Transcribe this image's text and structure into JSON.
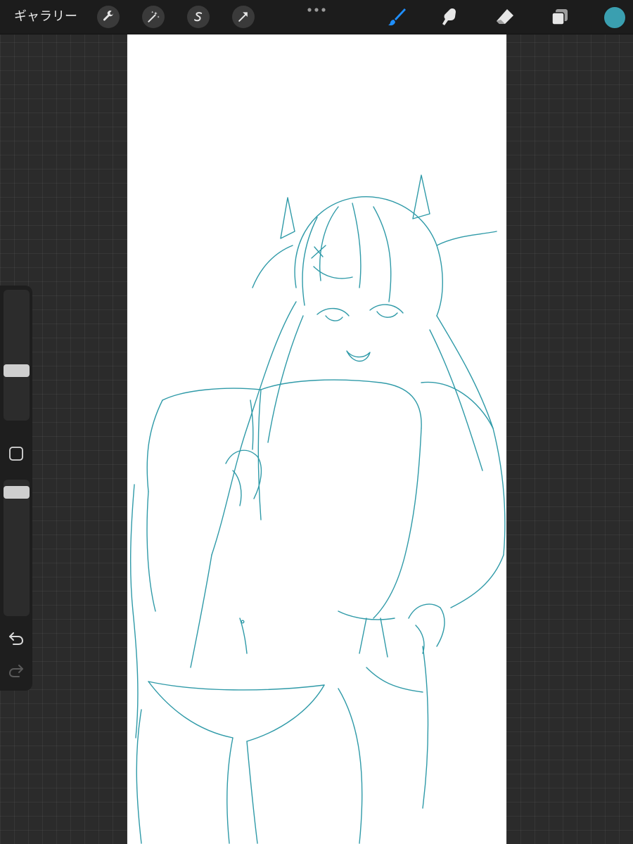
{
  "topbar": {
    "gallery_label": "ギャラリー",
    "left_tools": [
      {
        "name": "actions-button",
        "icon": "wrench-icon"
      },
      {
        "name": "adjustments-button",
        "icon": "magic-wand-icon"
      },
      {
        "name": "selection-button",
        "icon": "selection-s-icon"
      },
      {
        "name": "transform-button",
        "icon": "arrow-cursor-icon"
      }
    ],
    "more_icon": "more-dots-icon",
    "right_tools": [
      {
        "name": "brush-tool-button",
        "icon": "brush-icon",
        "active": true
      },
      {
        "name": "smudge-tool-button",
        "icon": "smudge-finger-icon",
        "active": false
      },
      {
        "name": "eraser-tool-button",
        "icon": "eraser-icon",
        "active": false
      },
      {
        "name": "layers-button",
        "icon": "layers-icon",
        "active": false
      }
    ],
    "current_color": "#3a9fb0"
  },
  "sidebar": {
    "brush_size": {
      "value": 0.36
    },
    "opacity": {
      "value": 0.97
    },
    "modify_icon": "square-modify-icon",
    "undo_icon": "undo-arrow-icon",
    "redo_icon": "redo-arrow-icon"
  },
  "canvas": {
    "background": "#ffffff",
    "line_color": "#2f9aa8",
    "content": "line-art-sketch"
  },
  "colors": {
    "accent_active": "#1f8fff",
    "icon_idle": "#e6e6e6",
    "tool_bg": "#3a3a3a"
  }
}
